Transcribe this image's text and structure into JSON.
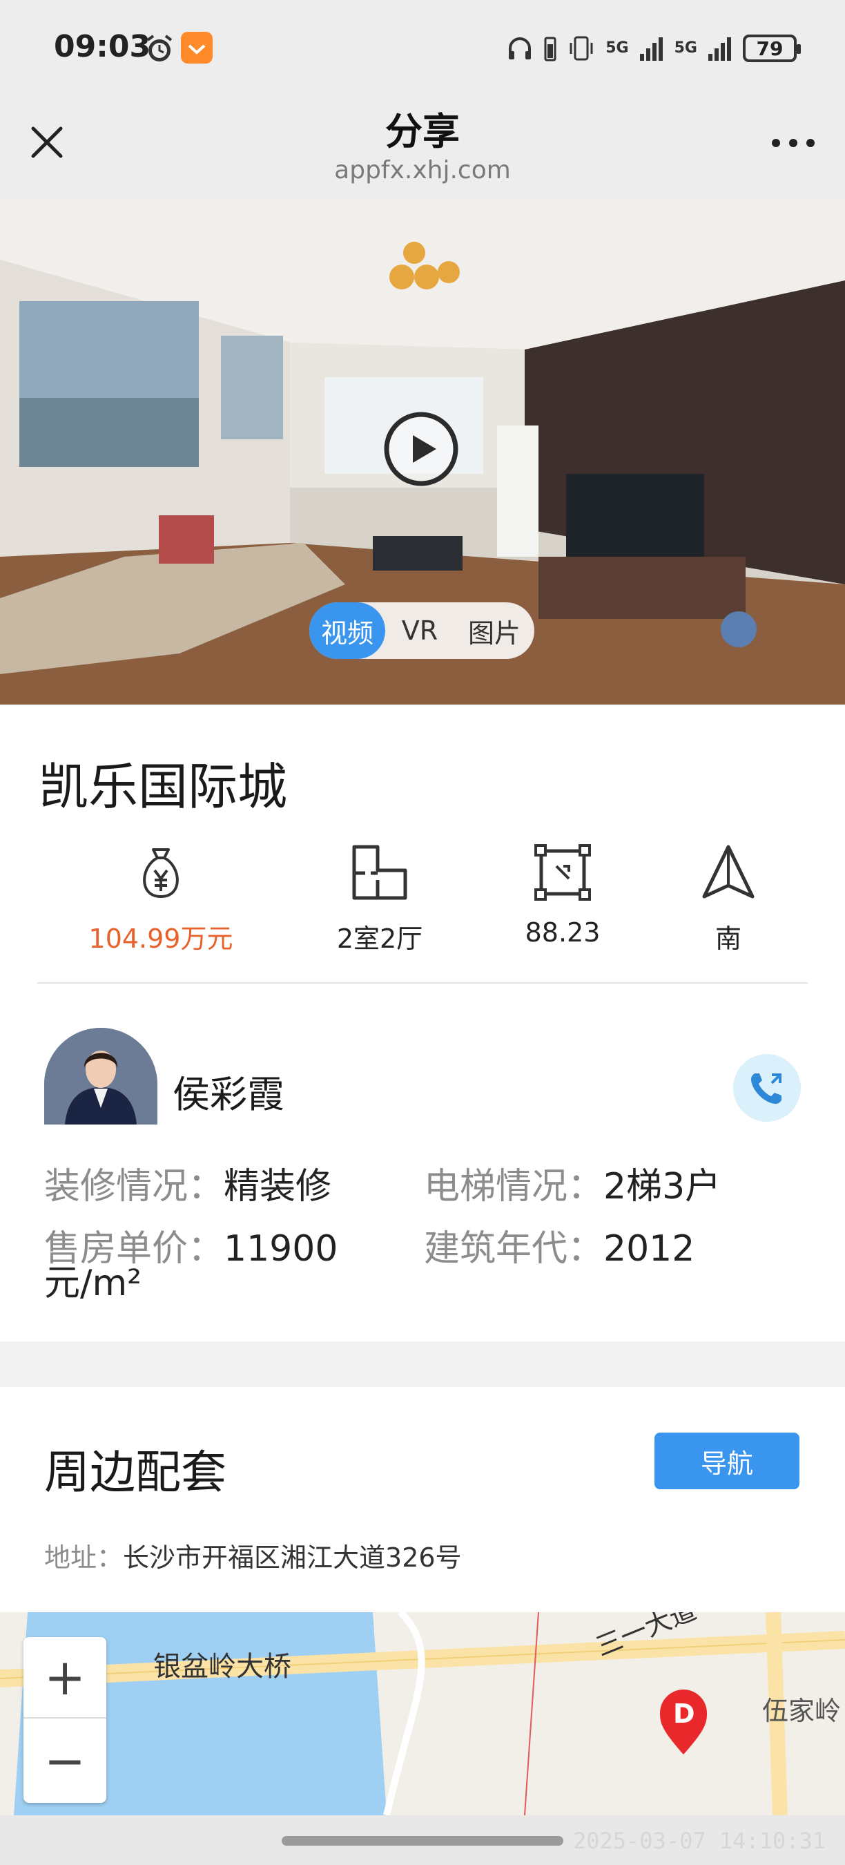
{
  "status_bar": {
    "time": "09:03",
    "battery": "79",
    "signal_1": "5G",
    "signal_2": "5G"
  },
  "header": {
    "title": "分享",
    "url": "appfx.xhj.com"
  },
  "hero": {
    "tabs": [
      {
        "label": "视频",
        "active": true
      },
      {
        "label": "VR",
        "active": false
      },
      {
        "label": "图片",
        "active": false
      }
    ]
  },
  "listing": {
    "title": "凯乐国际城",
    "stats": {
      "price": "104.99万元",
      "layout": "2室2厅",
      "area": "88.23",
      "orientation": "南"
    }
  },
  "agent": {
    "name": "侯彩霞"
  },
  "attributes": {
    "decoration_key": "装修情况：",
    "decoration_value": "精装修",
    "elevator_key": "电梯情况：",
    "elevator_value": "2梯3户",
    "unit_price_key": "售房单价：",
    "unit_price_value": "11900",
    "unit_price_unit": "元/m²",
    "year_key": "建筑年代：",
    "year_value": "2012"
  },
  "surroundings": {
    "title": "周边配套",
    "nav_label": "导航",
    "address_key": "地址：",
    "address_value": "长沙市开福区湘江大道326号"
  },
  "map": {
    "bridge_label": "银盆岭大桥",
    "road_label": "三一大道",
    "place_label": "伍家岭",
    "marker_label": "D",
    "zoom_in": "+",
    "zoom_out": "−"
  },
  "watermark_timestamp": "2025-03-07 14:10:31",
  "colors": {
    "accent": "#3a95ee",
    "price": "#e8622c",
    "map_water": "#9fd0f3"
  }
}
